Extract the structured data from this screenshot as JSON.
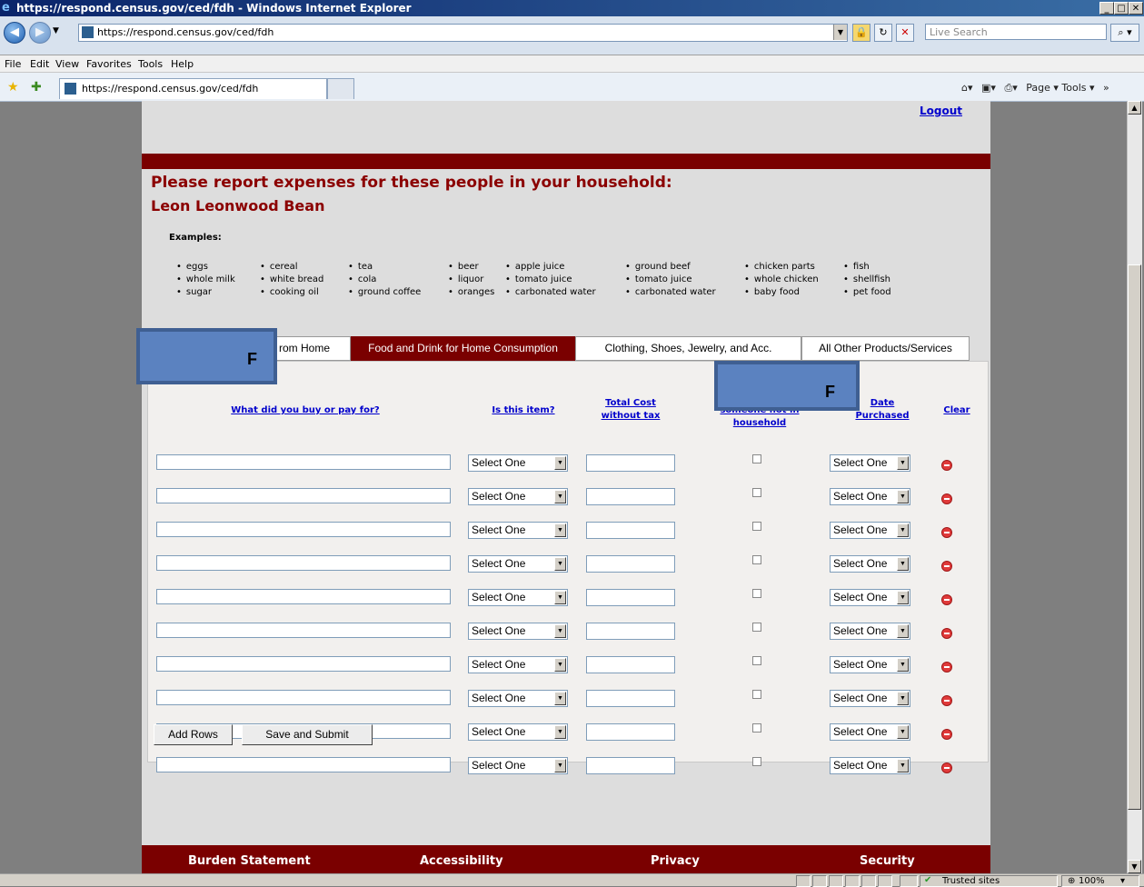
{
  "window": {
    "title": "https://respond.census.gov/ced/fdh - Windows Internet Explorer"
  },
  "browser": {
    "address": "https://respond.census.gov/ced/fdh",
    "search_placeholder": "Live Search",
    "tab_title": "https://respond.census.gov/ced/fdh",
    "menu": [
      "File",
      "Edit",
      "View",
      "Favorites",
      "Tools",
      "Help"
    ],
    "command_bar": "Page ▾  Tools ▾",
    "status_zone": "Trusted sites",
    "zoom": "100%"
  },
  "page": {
    "logout": "Logout",
    "heading": "Please report expenses for these people in your household:",
    "person": "Leon Leonwood Bean",
    "examples_label": "Examples:",
    "examples": [
      [
        "eggs",
        "whole milk",
        "sugar"
      ],
      [
        "cereal",
        "white bread",
        "cooking oil"
      ],
      [
        "tea",
        "cola",
        "ground coffee"
      ],
      [
        "beer",
        "liquor",
        "oranges"
      ],
      [
        "apple juice",
        "tomato juice",
        "carbonated water"
      ],
      [
        "ground beef",
        "tomato juice",
        "carbonated water"
      ],
      [
        "chicken parts",
        "whole chicken",
        "baby food"
      ],
      [
        "fish",
        "shellfish",
        "pet food"
      ]
    ],
    "tabs": {
      "away": "rom Home",
      "food": "Food and Drink for Home Consumption",
      "clothing": "Clothing, Shoes, Jewelry, and Acc.",
      "other": "All Other Products/Services"
    },
    "columns": {
      "what": "What did you buy or pay for?",
      "is_item": "Is this item?",
      "cost_line1": "Total Cost",
      "cost_line2": "without tax",
      "someone_line2": "someone not in",
      "someone_line3": "household",
      "date_line1": "Date",
      "date_line2": "Purchased",
      "clear": "Clear"
    },
    "select_placeholder": "Select One",
    "row_count": 10,
    "buttons": {
      "add_rows": "Add Rows",
      "save_submit": "Save and Submit"
    },
    "footer": {
      "burden": "Burden Statement",
      "accessibility": "Accessibility",
      "privacy": "Privacy",
      "security": "Security"
    },
    "overlay_labels": [
      "F",
      "F"
    ]
  }
}
